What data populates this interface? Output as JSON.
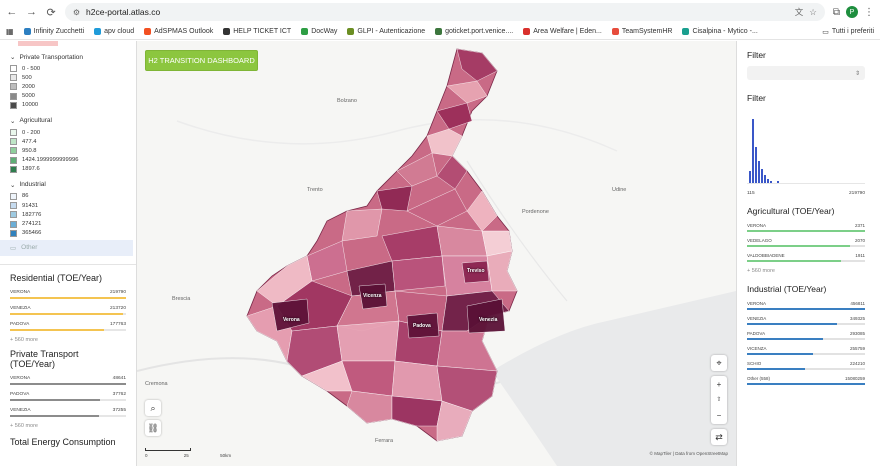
{
  "browser": {
    "url": "h2ce-portal.atlas.co",
    "avatar": "P",
    "bookmarks": [
      "Infinity Zucchetti",
      "apv cloud",
      "AdSPMAS Outlook",
      "HELP TICKET ICT",
      "DocWay",
      "GLPI - Autenticazione",
      "goticket.port.venice....",
      "Area Welfare | Eden...",
      "TeamSystemHR",
      "Cisalpina - Mytico -..."
    ],
    "all_bookmarks": "Tutti i preferiti"
  },
  "legend": {
    "groups": [
      {
        "title": "Private Transportation",
        "items": [
          "0 - 500",
          "500",
          "2000",
          "5000",
          "10000"
        ],
        "colors": [
          "#ffffff",
          "#e8e8e8",
          "#bdbdbd",
          "#8a8a8a",
          "#4a4a4a"
        ]
      },
      {
        "title": "Agricultural",
        "items": [
          "0 - 200",
          "477.4",
          "950.8",
          "1424.1999999999996",
          "1897.6"
        ],
        "colors": [
          "#eaf7ec",
          "#bfe6c7",
          "#8fcf9c",
          "#5fae76",
          "#2f7d4e"
        ]
      },
      {
        "title": "Industrial",
        "items": [
          "86",
          "91431",
          "182776",
          "274121",
          "365466"
        ],
        "colors": [
          "#eef4fb",
          "#c6dbef",
          "#9ecae1",
          "#6baed6",
          "#3182bd"
        ]
      }
    ],
    "other": "Other"
  },
  "left_stats": {
    "residential": {
      "title": "Residential (TOE/Year)",
      "more": "+ 560 more",
      "rows": [
        {
          "name": "VERONA",
          "value": "219790",
          "pct": 100
        },
        {
          "name": "VENEZIA",
          "value": "213720",
          "pct": 97
        },
        {
          "name": "PADOVA",
          "value": "177763",
          "pct": 81
        }
      ]
    },
    "private_transport": {
      "title": "Private Transport (TOE/Year)",
      "more": "+ 560 more",
      "rows": [
        {
          "name": "VERONA",
          "value": "48641",
          "pct": 100
        },
        {
          "name": "PADOVA",
          "value": "37762",
          "pct": 78
        },
        {
          "name": "VENEZIA",
          "value": "37255",
          "pct": 77
        }
      ]
    },
    "total_title": "Total Energy Consumption"
  },
  "map": {
    "dashboard_button": "H2 TRANSITION DASHBOARD",
    "places": [
      "Bolzano",
      "Trento",
      "Udine",
      "Pordenone",
      "Brescia",
      "Cremona",
      "Ferrara"
    ],
    "cities": [
      "Treviso",
      "Vicenza",
      "Verona",
      "Padova",
      "Venezia"
    ],
    "attribution": "© MapTiler | Data from OpenStreetMap",
    "scale_left": "0",
    "scale_mid": "25",
    "scale_right": "50km"
  },
  "right": {
    "filter1_title": "Filter",
    "filter2_title": "Filter",
    "hist_min": "115",
    "hist_max": "219790",
    "agricultural": {
      "title": "Agricultural (TOE/Year)",
      "more": "+ 560 more",
      "rows": [
        {
          "name": "VERONA",
          "value": "2371",
          "pct": 100
        },
        {
          "name": "VEDELAGO",
          "value": "2070",
          "pct": 87
        },
        {
          "name": "VALDOBBIADENE",
          "value": "1911",
          "pct": 80
        }
      ]
    },
    "industrial": {
      "title": "Industrial (TOE/Year)",
      "rows": [
        {
          "name": "VERONA",
          "value": "456811",
          "pct": 100
        },
        {
          "name": "VENEZIA",
          "value": "349325",
          "pct": 76
        },
        {
          "name": "PADOVA",
          "value": "293085",
          "pct": 64
        },
        {
          "name": "VICENZA",
          "value": "255759",
          "pct": 56
        },
        {
          "name": "SCHIO",
          "value": "224210",
          "pct": 49
        },
        {
          "name": "Other (558)",
          "value": "15080259",
          "pct": 100
        }
      ]
    }
  },
  "colors": {
    "accent_green": "#8cc63f",
    "residential_bar": "#f4c451",
    "transport_bar": "#8c8c8c",
    "agri_bar": "#7ccf88",
    "industrial_bar": "#3a7fc1"
  }
}
